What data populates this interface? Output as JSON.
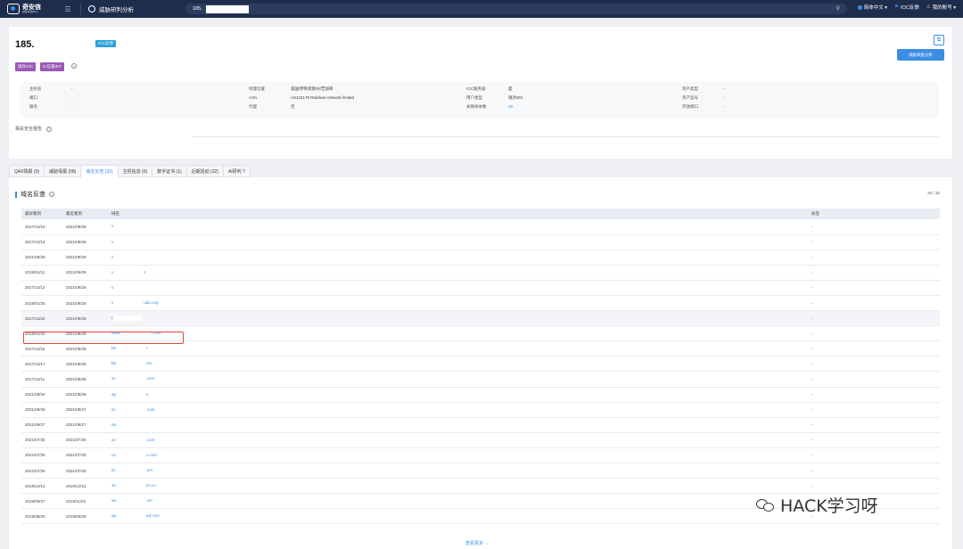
{
  "topbar": {
    "brand": "奇安信",
    "brand_sub": "威胁情报中心",
    "app_title": "威胁研判分析",
    "search_value": "185.",
    "lang": "简体中文 ▾",
    "ioc_feedback": "IOC反馈",
    "account": "我的账号 ▾"
  },
  "header": {
    "ip": "185.",
    "ioc_badge": "IOC反馈",
    "tags": [
      "境外IOC",
      "IC信誉IDT"
    ],
    "analyze_button": "威胁调查分析",
    "info": {
      "hostname_label": "主机名",
      "hostname": "-",
      "port_label": "端口",
      "port": "-",
      "service_label": "服务",
      "service": "-",
      "geo_label": "地理位置",
      "geo": "美国/伊利诺斯州/芝加哥",
      "asn_label": "ASN",
      "asn": "AS134176 Rainbow network limited",
      "proxy_label": "代理",
      "proxy": "否",
      "ioc_server_label": "IOC服务器",
      "ioc_server": "是",
      "user_type_label": "用户类型",
      "user_type": "境外IDC",
      "associated_label": "关联样本数",
      "associated": "29",
      "asset_type_label": "资产类型",
      "asset_type": "-",
      "asset_model_label": "资产型号",
      "asset_model": "-",
      "open_range_label": "开放端口",
      "open_range": "-"
    },
    "security_report_label": "相关安全报告"
  },
  "tabs": [
    "QAX情报 (0)",
    "威胁情报 (58)",
    "域名反查 (32)",
    "主机信息 (0)",
    "数字证书 (1)",
    "近期活动 (32)",
    "AI研判 ?"
  ],
  "active_tab": 2,
  "section": {
    "title": "域名反查",
    "count": "20 / 32",
    "columns": [
      "最早看到",
      "最近看到",
      "域名",
      "标签"
    ],
    "view_more": "查看更多 →"
  },
  "rows": [
    {
      "first": "2017/12/10",
      "last": "2021/09/28",
      "domain_head": "s",
      "domain_tail": "",
      "tag": "-"
    },
    {
      "first": "2017/12/14",
      "last": "2021/09/28",
      "domain_head": "v",
      "domain_tail": "",
      "tag": "-"
    },
    {
      "first": "2021/09/26",
      "last": "2021/09/28",
      "domain_head": "z",
      "domain_tail": "",
      "tag": "-"
    },
    {
      "first": "2019/01/12",
      "last": "2021/09/28",
      "domain_head": "v",
      "domain_tail": "s",
      "tag": "-"
    },
    {
      "first": "2017/12/12",
      "last": "2021/09/28",
      "domain_head": "s",
      "domain_tail": "",
      "tag": "-"
    },
    {
      "first": "2019/01/25",
      "last": "2021/09/28",
      "domain_head": "z",
      "domain_tail": "udio.org",
      "tag": "-"
    },
    {
      "first": "2017/12/24",
      "last": "2021/09/28",
      "domain_head": "t",
      "domain_tail": "",
      "tag": "-"
    },
    {
      "first": "2019/01/20",
      "last": "2021/09/28",
      "domain_head": "www.",
      "domain_tail": "l.com",
      "tag": "-"
    },
    {
      "first": "2017/12/16",
      "last": "2021/09/28",
      "domain_head": "bb",
      "domain_tail": "i",
      "tag": "-"
    },
    {
      "first": "2017/12/17",
      "last": "2021/09/28",
      "domain_head": "bb",
      "domain_tail": "om",
      "tag": "-"
    },
    {
      "first": "2017/12/11",
      "last": "2021/09/28",
      "domain_head": "ss",
      "domain_tail": ".com",
      "tag": "-"
    },
    {
      "first": "2021/09/24",
      "last": "2021/09/28",
      "domain_head": "ap",
      "domain_tail": "n",
      "tag": "-"
    },
    {
      "first": "2021/09/26",
      "last": "2021/09/27",
      "domain_head": "ac",
      "domain_tail": ".com",
      "tag": "-"
    },
    {
      "first": "2021/09/27",
      "last": "2021/09/27",
      "domain_head": "sw",
      "domain_tail": "",
      "tag": "-"
    },
    {
      "first": "2021/07/30",
      "last": "2021/07/30",
      "domain_head": "av",
      "domain_tail": ".com",
      "tag": "-"
    },
    {
      "first": "2021/07/30",
      "last": "2021/07/30",
      "domain_head": "ce",
      "domain_tail": "c.com",
      "tag": "-"
    },
    {
      "first": "2021/07/30",
      "last": "2021/07/30",
      "domain_head": "lin",
      "domain_tail": ".om",
      "tag": "-"
    },
    {
      "first": "2019/12/12",
      "last": "2019/12/12",
      "domain_head": "4e",
      "domain_tail": "xn.cn",
      "tag": "-"
    },
    {
      "first": "2019/09/27",
      "last": "2019/11/02",
      "domain_head": "wx",
      "domain_tail": "om",
      "tag": "-"
    },
    {
      "first": "2019/05/25",
      "last": "2019/05/25",
      "domain_head": "ap",
      "domain_tail": "ed.com",
      "tag": "-"
    }
  ],
  "watermark": "HACK学习呀"
}
